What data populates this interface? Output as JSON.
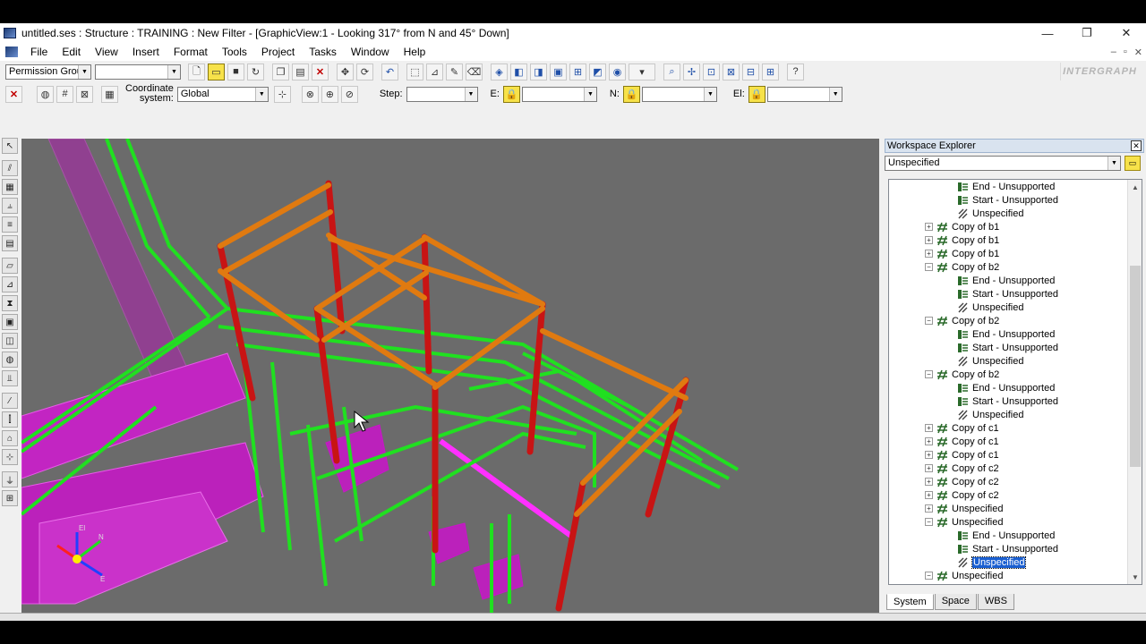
{
  "window": {
    "title": "untitled.ses : Structure : TRAINING : New Filter - [GraphicView:1 - Looking 317° from N and 45° Down]",
    "minimize": "—",
    "restore": "❐",
    "close": "✕"
  },
  "menu": {
    "items": [
      "File",
      "Edit",
      "View",
      "Insert",
      "Format",
      "Tools",
      "Project",
      "Tasks",
      "Window",
      "Help"
    ],
    "mdi": [
      "–",
      "▫",
      "✕"
    ]
  },
  "toolbar": {
    "permission_group": "Permission Group",
    "coordinate_label_1": "Coordinate",
    "coordinate_label_2": "system:",
    "coordinate_value": "Global",
    "step_label": "Step:",
    "e_label": "E:",
    "n_label": "N:",
    "el_label": "El:",
    "brand": "INTERGRAPH"
  },
  "explorer": {
    "title": "Workspace Explorer",
    "close": "✕",
    "filter_value": "Unspecified",
    "tree": [
      {
        "label": "End - Unsupported",
        "level": 2,
        "icon": "member-end"
      },
      {
        "label": "Start - Unsupported",
        "level": 2,
        "icon": "member-end"
      },
      {
        "label": "Unspecified",
        "level": 2,
        "icon": "axis"
      },
      {
        "label": "Copy of b1",
        "level": 1,
        "icon": "member",
        "expander": "+"
      },
      {
        "label": "Copy of b1",
        "level": 1,
        "icon": "member",
        "expander": "+"
      },
      {
        "label": "Copy of b1",
        "level": 1,
        "icon": "member",
        "expander": "+"
      },
      {
        "label": "Copy of b2",
        "level": 1,
        "icon": "member",
        "expander": "−"
      },
      {
        "label": "End - Unsupported",
        "level": 2,
        "icon": "member-end"
      },
      {
        "label": "Start - Unsupported",
        "level": 2,
        "icon": "member-end"
      },
      {
        "label": "Unspecified",
        "level": 2,
        "icon": "axis"
      },
      {
        "label": "Copy of b2",
        "level": 1,
        "icon": "member",
        "expander": "−"
      },
      {
        "label": "End - Unsupported",
        "level": 2,
        "icon": "member-end"
      },
      {
        "label": "Start - Unsupported",
        "level": 2,
        "icon": "member-end"
      },
      {
        "label": "Unspecified",
        "level": 2,
        "icon": "axis"
      },
      {
        "label": "Copy of b2",
        "level": 1,
        "icon": "member",
        "expander": "−"
      },
      {
        "label": "End - Unsupported",
        "level": 2,
        "icon": "member-end"
      },
      {
        "label": "Start - Unsupported",
        "level": 2,
        "icon": "member-end"
      },
      {
        "label": "Unspecified",
        "level": 2,
        "icon": "axis"
      },
      {
        "label": "Copy of c1",
        "level": 1,
        "icon": "member",
        "expander": "+"
      },
      {
        "label": "Copy of c1",
        "level": 1,
        "icon": "member",
        "expander": "+"
      },
      {
        "label": "Copy of c1",
        "level": 1,
        "icon": "member",
        "expander": "+"
      },
      {
        "label": "Copy of c2",
        "level": 1,
        "icon": "member",
        "expander": "+"
      },
      {
        "label": "Copy of c2",
        "level": 1,
        "icon": "member",
        "expander": "+"
      },
      {
        "label": "Copy of c2",
        "level": 1,
        "icon": "member",
        "expander": "+"
      },
      {
        "label": "Unspecified",
        "level": 1,
        "icon": "member",
        "expander": "+"
      },
      {
        "label": "Unspecified",
        "level": 1,
        "icon": "member",
        "expander": "−"
      },
      {
        "label": "End - Unsupported",
        "level": 2,
        "icon": "member-end"
      },
      {
        "label": "Start - Unsupported",
        "level": 2,
        "icon": "member-end"
      },
      {
        "label": "Unspecified",
        "level": 2,
        "icon": "axis",
        "selected": true
      },
      {
        "label": "Unspecified",
        "level": 1,
        "icon": "member",
        "expander": "−"
      }
    ],
    "tabs": [
      "System",
      "Space",
      "WBS"
    ],
    "active_tab": "System"
  },
  "viewport": {
    "triad_labels": [
      "El",
      "N",
      "E"
    ],
    "colors": {
      "background": "#6b6b6b",
      "pipe": "#1ee01e",
      "equipment": "#e020e0",
      "beam": "#e07a10",
      "column": "#c81414"
    }
  }
}
